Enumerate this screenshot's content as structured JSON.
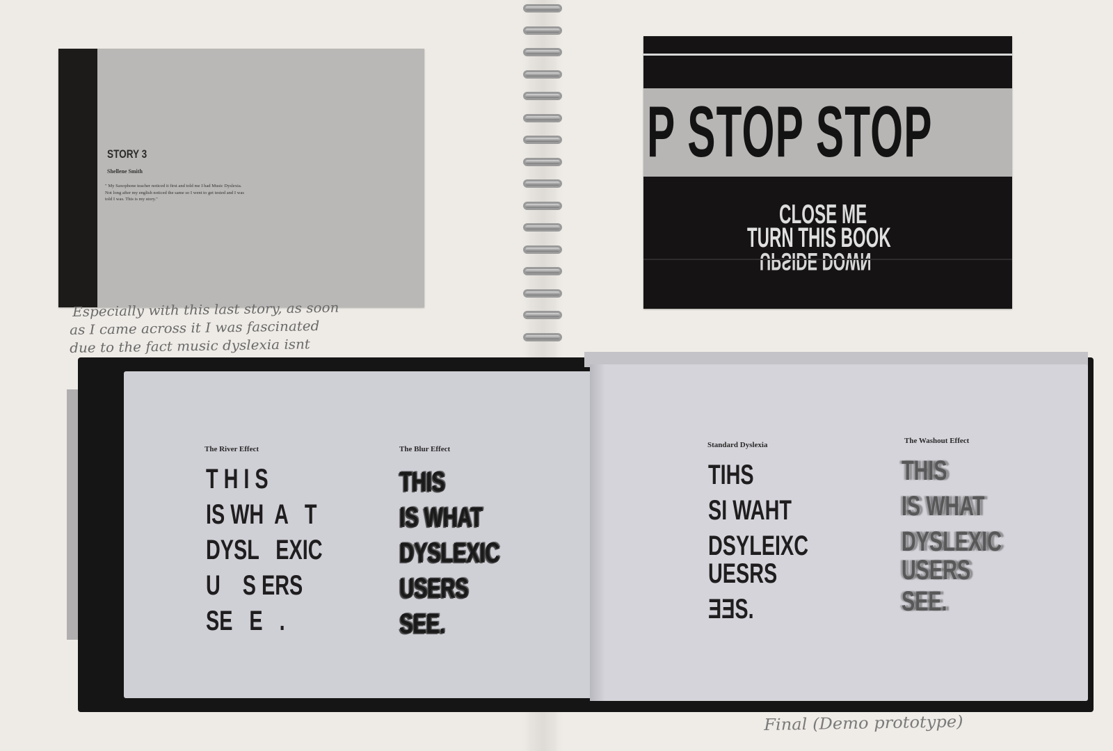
{
  "story_card": {
    "title": "STORY 3",
    "author": "Shellene Smith",
    "quote": "\" My Saxophone teacher noticed it first and told me I had Music Dyslexia. Not long after my english noticed the same so I went to get tested and I was told I was. This is my story.\""
  },
  "handwritten_note": {
    "line1": "Especially with this last story, as soon",
    "line2": "as I came across it I was fascinated",
    "line3": "due to the fact music dyslexia isnt"
  },
  "stop_card": {
    "stop_text": "P STOP STOP",
    "close_me": "CLOSE ME",
    "turn_book": "TURN THIS BOOK",
    "upside_down": "UPSIDE DOWN"
  },
  "book": {
    "river": {
      "label": "The River Effect",
      "lines": [
        "T H I S",
        "IS WH  A   T",
        "DYSL   EXIC",
        "U    S ERS",
        "SE   E   ."
      ]
    },
    "blur": {
      "label": "The Blur Effect",
      "lines": [
        "THIS",
        "IS WHAT",
        "DYSLEXIC",
        "USERS",
        "SEE."
      ]
    },
    "standard": {
      "label": "Standard Dyslexia",
      "lines": [
        "TIHS",
        "SI WAHT",
        "DSYLEIXC",
        "UESRS",
        "ƎƎS."
      ]
    },
    "washout": {
      "label": "The Washout Effect",
      "lines": [
        "THIS",
        "IS WHAT",
        "DYSLEXIC",
        "USERS",
        "SEE."
      ]
    }
  },
  "final_note": "Final (Demo prototype)"
}
